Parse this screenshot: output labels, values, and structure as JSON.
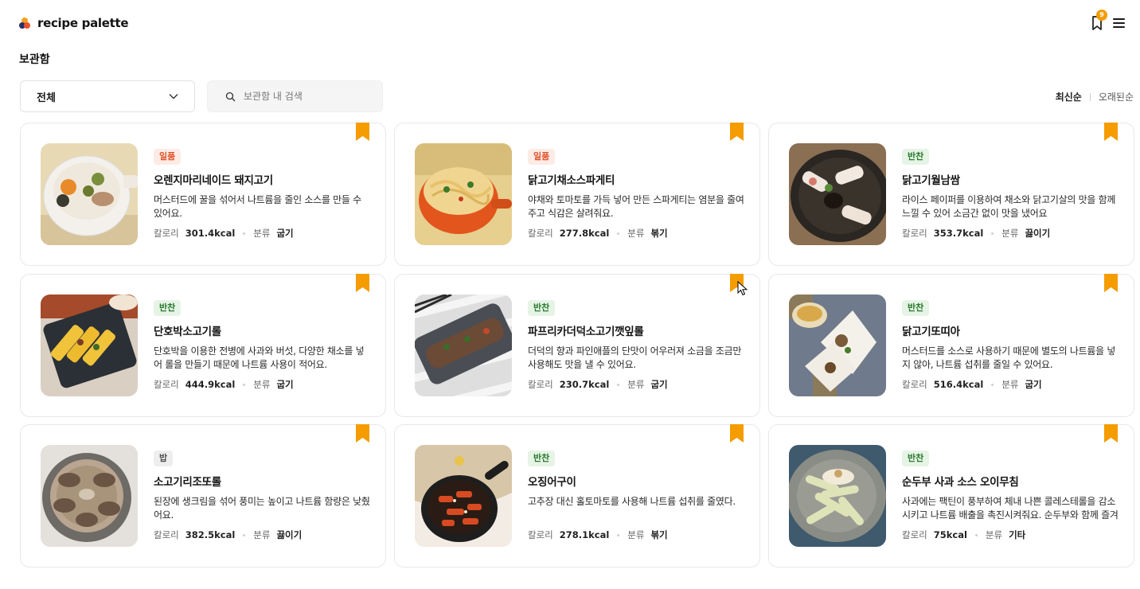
{
  "app": {
    "name": "recipe palette",
    "bookmark_count": "9"
  },
  "page": {
    "title": "보관함"
  },
  "filter": {
    "selected": "전체"
  },
  "search": {
    "placeholder": "보관함 내 검색"
  },
  "sort": {
    "active": "최신순",
    "inactive": "오래된순"
  },
  "labels": {
    "calories": "칼로리",
    "category": "분류"
  },
  "colors": {
    "accent": "#f49c00",
    "tag_red": "#e0532a",
    "tag_green": "#2a7a2e"
  },
  "cards": [
    {
      "tag": "일품",
      "tag_color": "red",
      "title": "오렌지마리네이드 돼지고기",
      "desc": "머스터드에 꿀을 섞어서 나트륨을 줄인 소스를 만들 수 있어요.",
      "kcal": "301.4kcal",
      "method": "굽기",
      "image": "pork-orange-bowl"
    },
    {
      "tag": "일품",
      "tag_color": "red",
      "title": "닭고기채소스파게티",
      "desc": "야채와 토마토를 가득 넣어 만든 스파게티는 염분을 줄여주고 식감은 살려줘요.",
      "kcal": "277.8kcal",
      "method": "볶기",
      "image": "spaghetti-orange-pot"
    },
    {
      "tag": "반찬",
      "tag_color": "green",
      "title": "닭고기월남쌈",
      "desc": "라이스 페이퍼를 이용하여 채소와 닭고기살의 맛을 함께 느낄 수 있어 소금간 없이 맛을 냈어요",
      "kcal": "353.7kcal",
      "method": "끓이기",
      "image": "spring-rolls-plate"
    },
    {
      "tag": "반찬",
      "tag_color": "green",
      "title": "단호박소고기롤",
      "desc": "단호박을 이용한 전병에 사과와 버섯, 다양한 채소를 넣어 롤을 만들기 때문에 나트륨 사용이 적어요.",
      "kcal": "444.9kcal",
      "method": "굽기",
      "image": "pumpkin-rolls"
    },
    {
      "tag": "반찬",
      "tag_color": "green",
      "title": "파프리카더덕소고기깻잎롤",
      "desc": "더덕의 향과 파인애플의 단맛이 어우러져 소금을 조금만 사용해도 맛을 낼 수 있어요.",
      "kcal": "230.7kcal",
      "method": "굽기",
      "image": "beef-perilla-roll"
    },
    {
      "tag": "반찬",
      "tag_color": "green",
      "title": "닭고기또띠아",
      "desc": "머스터드를 소스로 사용하기 때문에 별도의 나트륨을 넣지 않아, 나트륨 섭취를 줄일 수 있어요.",
      "kcal": "516.4kcal",
      "method": "굽기",
      "image": "chicken-tortilla"
    },
    {
      "tag": "밥",
      "tag_color": "gray",
      "title": "소고기리조또롤",
      "desc": "된장에 생크림을 섞어 풍미는 높이고 나트륨 함량은 낮췄어요.",
      "kcal": "382.5kcal",
      "method": "끓이기",
      "image": "risotto-rolls-pot"
    },
    {
      "tag": "반찬",
      "tag_color": "green",
      "title": "오징어구이",
      "desc": "고추장 대신 홀토마토를 사용해 나트륨 섭취를 줄였다.",
      "kcal": "278.1kcal",
      "method": "볶기",
      "image": "squid-skillet"
    },
    {
      "tag": "반찬",
      "tag_color": "green",
      "title": "순두부 사과 소스 오이무침",
      "desc": "사과에는 팩틴이 풍부하여 체내 나쁜 콜레스테롤을 감소시키고 나트륨 배출을 촉진시켜줘요. 순두부와 함께 즐겨요.",
      "kcal": "75kcal",
      "method": "기타",
      "image": "cucumber-salad"
    }
  ]
}
